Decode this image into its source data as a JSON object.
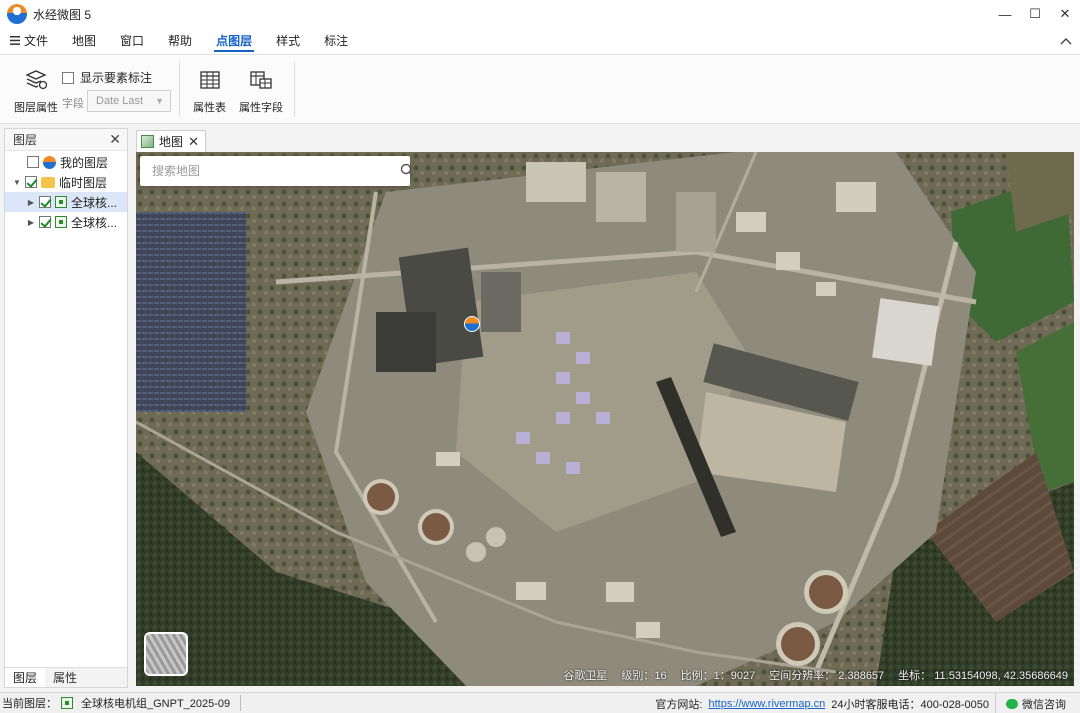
{
  "app": {
    "title": "水经微图 5"
  },
  "window": {
    "minimize": "—",
    "maximize": "☐",
    "close": "✕"
  },
  "menu": {
    "file": "文件",
    "items": [
      "地图",
      "窗口",
      "帮助",
      "点图层",
      "样式",
      "标注"
    ],
    "active_index": 3
  },
  "ribbon": {
    "layer_props": "图层属性",
    "show_labels": "显示要素标注",
    "field_label": "字段",
    "field_value": "Date Last",
    "attr_table": "属性表",
    "attr_fields": "属性字段"
  },
  "left_panel": {
    "title": "图层",
    "tree": [
      {
        "label": "我的图层",
        "icon": "globe-icon",
        "checked": false
      },
      {
        "label": "临时图层",
        "icon": "folder-icon",
        "checked": true
      },
      {
        "label": "全球核...",
        "icon": "layer-icon",
        "checked": true
      },
      {
        "label": "全球核...",
        "icon": "layer-icon",
        "checked": true
      }
    ],
    "tabs": [
      "图层",
      "属性"
    ]
  },
  "doc_tab": {
    "label": "地图"
  },
  "map": {
    "search_placeholder": "搜索地图",
    "source": "谷歌卫星",
    "level": "级别：16",
    "scale": "比例：1：9027",
    "resolution": "空间分辨率：  2.388657",
    "coords": "坐标：  11.53154098, 42.35686649"
  },
  "statusbar": {
    "current_layer_label": "当前图层：",
    "current_layer": "全球核电机组_GNPT_2025-09",
    "site_label": "官方网站:",
    "site_url": "https://www.rivermap.cn",
    "hotline": "24小时客服电话：400-028-0050",
    "wechat": "微信咨询"
  }
}
